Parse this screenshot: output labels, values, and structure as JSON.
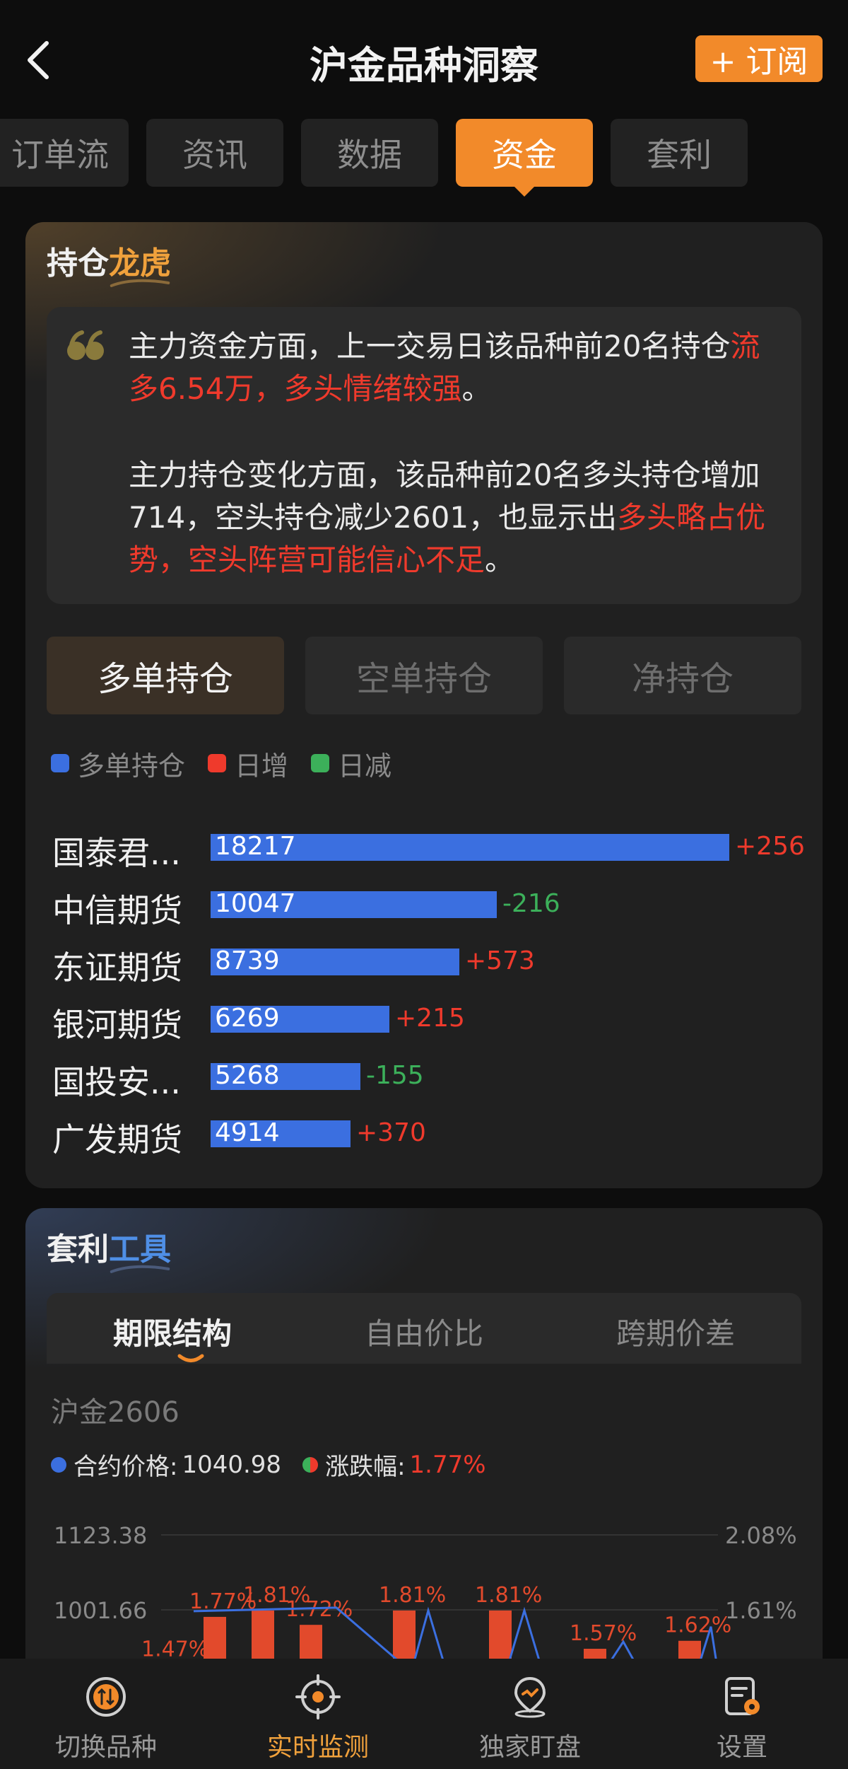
{
  "header": {
    "title": "沪金品种洞察",
    "subscribe_label": "+ 订阅"
  },
  "tabs": [
    {
      "label": "订单流"
    },
    {
      "label": "资讯"
    },
    {
      "label": "数据"
    },
    {
      "label": "资金",
      "active": true
    },
    {
      "label": "套利"
    }
  ],
  "positions_card": {
    "title_plain": "持仓",
    "title_highlight": "龙虎",
    "quote": {
      "p1_normal": "主力资金方面，上一交易日该品种前20名持仓",
      "p1_red": "流多6.54万，多头情绪较强",
      "p1_end": "。",
      "p2_normal": "主力持仓变化方面，该品种前20名多头持仓增加714，空头持仓减少2601，也显示出",
      "p2_red": "多头略占优势，空头阵营可能信心不足",
      "p2_end": "。"
    },
    "segments": [
      {
        "label": "多单持仓",
        "active": true
      },
      {
        "label": "空单持仓"
      },
      {
        "label": "净持仓"
      }
    ],
    "legend": [
      {
        "label": "多单持仓",
        "color": "#3b6fe0"
      },
      {
        "label": "日增",
        "color": "#ef3a2c"
      },
      {
        "label": "日减",
        "color": "#3cb05a"
      }
    ],
    "rows": [
      {
        "name": "国泰君...",
        "value": "18217",
        "change": "+256",
        "dir": "up"
      },
      {
        "name": "中信期货",
        "value": "10047",
        "change": "-216",
        "dir": "down"
      },
      {
        "name": "东证期货",
        "value": "8739",
        "change": "+573",
        "dir": "up"
      },
      {
        "name": "银河期货",
        "value": "6269",
        "change": "+215",
        "dir": "up"
      },
      {
        "name": "国投安...",
        "value": "5268",
        "change": "-155",
        "dir": "down"
      },
      {
        "name": "广发期货",
        "value": "4914",
        "change": "+370",
        "dir": "up"
      }
    ]
  },
  "arbitrage_card": {
    "title_plain": "套利",
    "title_highlight": "工具",
    "subtabs": [
      {
        "label": "期限结构",
        "active": true
      },
      {
        "label": "自由价比"
      },
      {
        "label": "跨期价差"
      }
    ],
    "contract": "沪金2606",
    "legend": {
      "price_label": "合约价格:",
      "price_value": "1040.98",
      "change_label": "涨跌幅:",
      "change_value": "1.77%"
    }
  },
  "chart_data": {
    "type": "bar",
    "y_left_ticks": [
      "1123.38",
      "1001.66"
    ],
    "y_right_ticks": [
      "2.08%",
      "1.61%"
    ],
    "bar_labels": [
      "1.47%",
      "1.77%",
      "1.81%",
      "1.72%",
      "1.81%",
      "1.81%",
      "1.57%",
      "1.62%"
    ],
    "bar_values": [
      1.47,
      1.77,
      1.81,
      1.72,
      1.81,
      1.81,
      1.57,
      1.62
    ],
    "right_axis_range": [
      1.61,
      2.08
    ],
    "left_axis_range": [
      1001.66,
      1123.38
    ],
    "bar_color": "#e24a2c",
    "line_color": "#3b6fe0"
  },
  "nav": [
    {
      "label": "切换品种",
      "icon": "switch-icon"
    },
    {
      "label": "实时监测",
      "icon": "target-icon",
      "active": true
    },
    {
      "label": "独家盯盘",
      "icon": "location-icon"
    },
    {
      "label": "设置",
      "icon": "settings-icon"
    }
  ]
}
